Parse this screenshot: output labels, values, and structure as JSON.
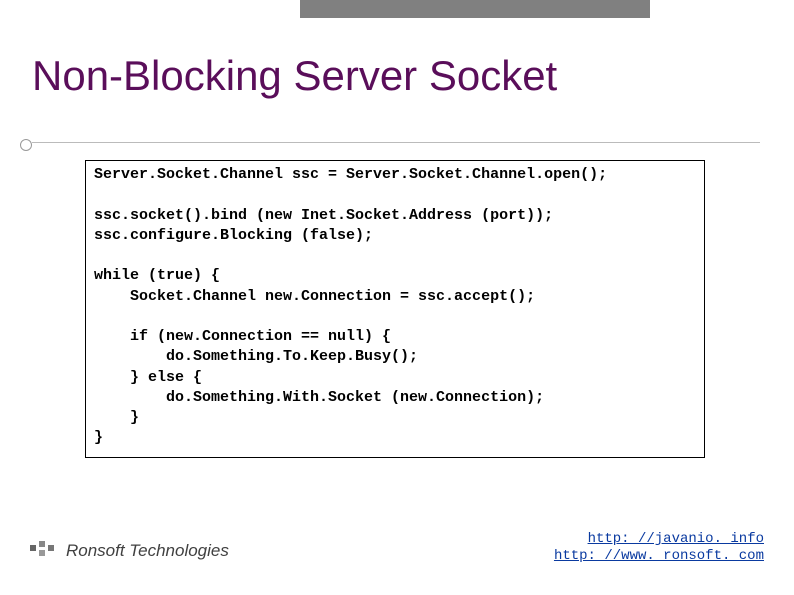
{
  "title": "Non-Blocking Server Socket",
  "code": "Server.Socket.Channel ssc = Server.Socket.Channel.open();\n\nssc.socket().bind (new Inet.Socket.Address (port));\nssc.configure.Blocking (false);\n\nwhile (true) {\n    Socket.Channel new.Connection = ssc.accept();\n\n    if (new.Connection == null) {\n        do.Something.To.Keep.Busy();\n    } else {\n        do.Something.With.Socket (new.Connection);\n    }\n}",
  "footer": {
    "company": "Ronsoft Technologies",
    "link1_text": "http: //javanio. info",
    "link2_text": "http: //www. ronsoft. com"
  }
}
